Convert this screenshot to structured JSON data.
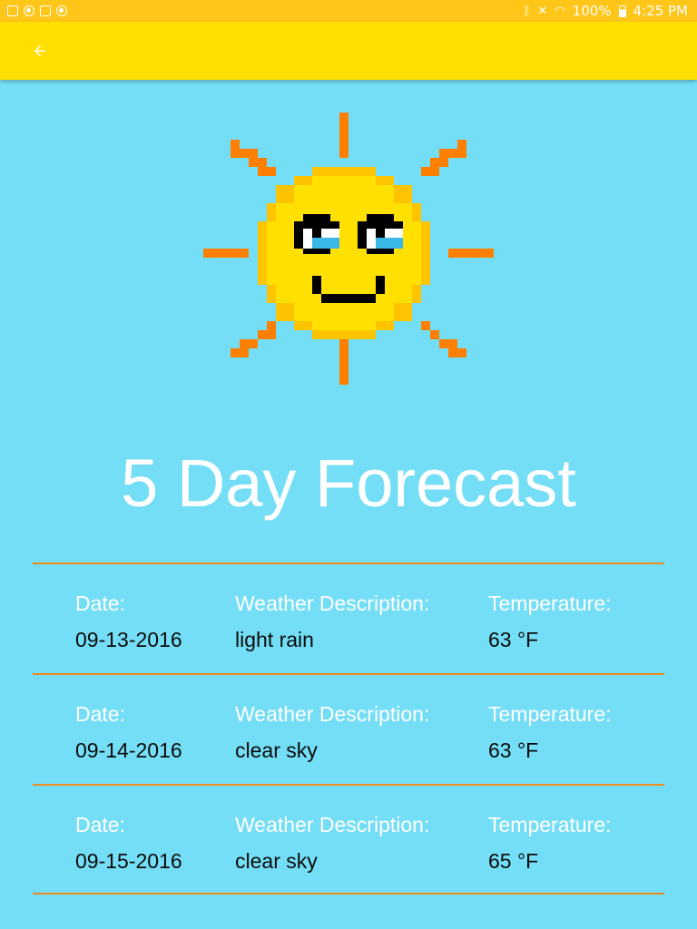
{
  "status_bar": {
    "battery": "100%",
    "time": "4:25 PM",
    "colors": {
      "bar": "#ffc61a"
    }
  },
  "app_bar": {
    "back_icon": "arrow-back-icon",
    "color": "#ffde00"
  },
  "main": {
    "illustration": "smiling-sun-icon",
    "title": "5 Day Forecast"
  },
  "forecast": {
    "labels": {
      "date": "Date:",
      "description": "Weather Description:",
      "temperature": "Temperature:"
    },
    "rows": [
      {
        "date": "09-13-2016",
        "description": "light rain",
        "temperature": "63 °F"
      },
      {
        "date": "09-14-2016",
        "description": "clear sky",
        "temperature": "63 °F"
      },
      {
        "date": "09-15-2016",
        "description": "clear sky",
        "temperature": "65 °F"
      }
    ]
  },
  "colors": {
    "background": "#74def6",
    "divider": "#f08a1c",
    "sun": "#ffd000",
    "rays": "#ff7f00"
  }
}
